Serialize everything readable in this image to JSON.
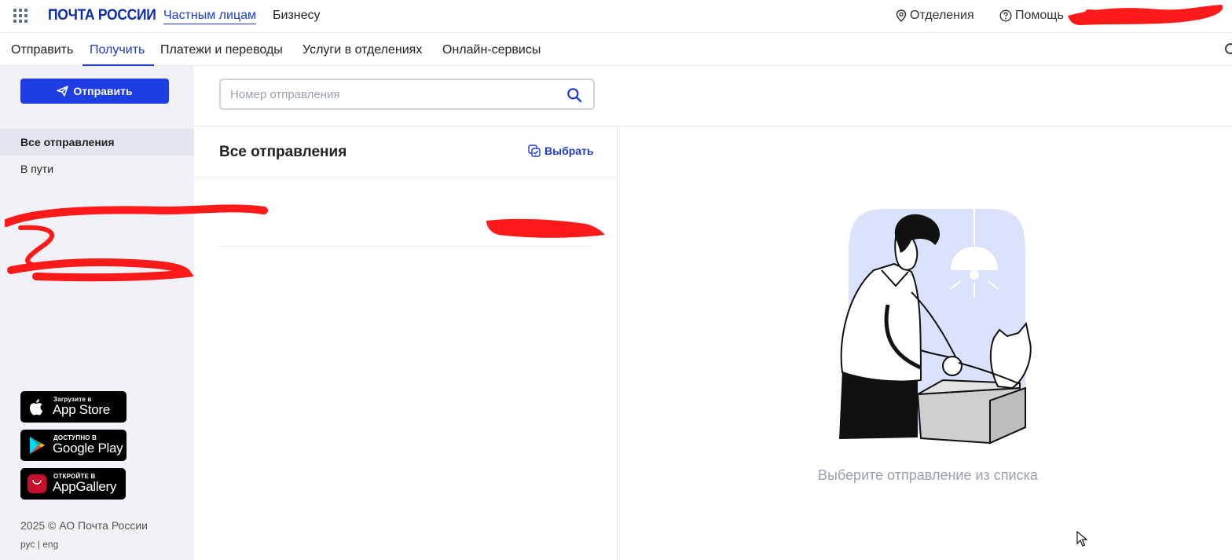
{
  "header": {
    "logo_text": "ПОЧТА РОССИИ",
    "nav": [
      "Частным лицам",
      "Бизнесу"
    ],
    "offices_label": "Отделения",
    "help_label": "Помощь"
  },
  "subnav": {
    "items": [
      "Отправить",
      "Получить",
      "Платежи и переводы",
      "Услуги в отделениях",
      "Онлайн-сервисы"
    ],
    "active": "Получить"
  },
  "sidebar": {
    "send_button": "Отправить",
    "items": [
      "Все отправления",
      "В пути"
    ],
    "active_item": "Все отправления",
    "stores": [
      {
        "small": "Загрузите в",
        "large": "App Store",
        "icon": "apple-icon"
      },
      {
        "small": "ДОСТУПНО В",
        "large": "Google Play",
        "icon": "google-play-icon"
      },
      {
        "small": "ОТКРОЙТЕ В",
        "large": "AppGallery",
        "icon": "huawei-icon"
      }
    ],
    "copyright": "2025 © АО Почта России",
    "lang": {
      "ru": "рус",
      "sep": "|",
      "en": "eng"
    }
  },
  "main": {
    "search_placeholder": "Номер отправления",
    "list_title": "Все отправления",
    "select_label": "Выбрать",
    "empty_text": "Выберите отправление из списка"
  },
  "colors": {
    "brand": "#1d3bcc",
    "button": "#1e3de3",
    "sidebar_bg": "#f1f2f8",
    "redaction": "#ff0000"
  }
}
